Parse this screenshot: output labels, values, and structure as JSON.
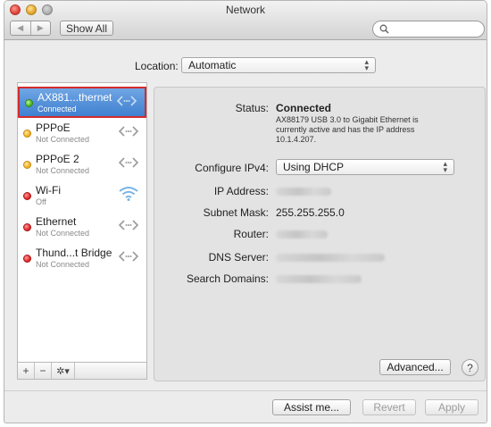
{
  "window": {
    "title": "Network"
  },
  "toolbar": {
    "back_glyph": "◀",
    "forward_glyph": "▶",
    "show_all_label": "Show All",
    "search_placeholder": ""
  },
  "location": {
    "label": "Location:",
    "value": "Automatic"
  },
  "services": [
    {
      "name": "AX881...thernet",
      "status": "Connected",
      "status_color": "green",
      "icon": "ethernet-icon",
      "selected": true
    },
    {
      "name": "PPPoE",
      "status": "Not Connected",
      "status_color": "yellow",
      "icon": "ethernet-icon"
    },
    {
      "name": "PPPoE 2",
      "status": "Not Connected",
      "status_color": "yellow",
      "icon": "ethernet-icon"
    },
    {
      "name": "Wi-Fi",
      "status": "Off",
      "status_color": "red",
      "icon": "wifi-icon"
    },
    {
      "name": "Ethernet",
      "status": "Not Connected",
      "status_color": "red",
      "icon": "ethernet-icon"
    },
    {
      "name": "Thund...t Bridge",
      "status": "Not Connected",
      "status_color": "red",
      "icon": "ethernet-icon"
    }
  ],
  "sidebar_tools": {
    "add": "+",
    "remove": "−",
    "gear": "✲▾"
  },
  "detail": {
    "status_label": "Status:",
    "status_value": "Connected",
    "status_description": "AX88179 USB 3.0 to Gigabit Ethernet is currently active and has the IP address 10.1.4.207.",
    "configure_label": "Configure IPv4:",
    "configure_value": "Using DHCP",
    "ip_label": "IP Address:",
    "subnet_label": "Subnet Mask:",
    "subnet_value": "255.255.255.0",
    "router_label": "Router:",
    "dns_label": "DNS Server:",
    "search_domains_label": "Search Domains:",
    "advanced_label": "Advanced...",
    "help_label": "?"
  },
  "footer": {
    "assist_label": "Assist me...",
    "revert_label": "Revert",
    "apply_label": "Apply"
  },
  "colors": {
    "selection": "#4a89d6",
    "selection_outline": "#d32b2b",
    "status_green": "#47b720",
    "status_yellow": "#f0ac1c",
    "status_red": "#e02424"
  }
}
